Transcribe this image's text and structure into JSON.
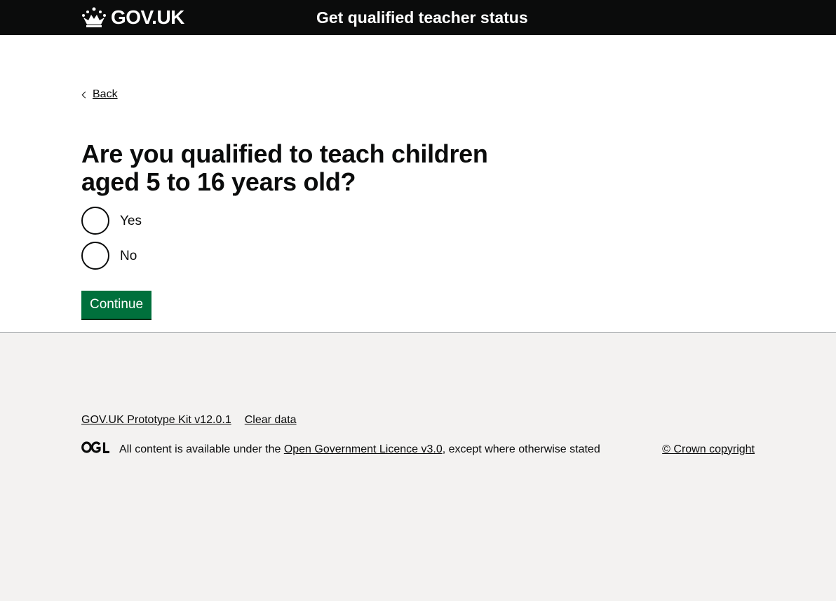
{
  "header": {
    "logo_text": "GOV.UK",
    "service_name": "Get qualified teacher status"
  },
  "nav": {
    "back_label": "Back"
  },
  "question": {
    "heading": "Are you qualified to teach children aged 5 to 16 years old?",
    "options": [
      {
        "label": "Yes",
        "selected": false
      },
      {
        "label": "No",
        "selected": false
      }
    ]
  },
  "actions": {
    "continue_label": "Continue"
  },
  "footer": {
    "links": [
      "GOV.UK Prototype Kit v12.0.1",
      "Clear data"
    ],
    "licence_prefix": "All content is available under the ",
    "licence_link": "Open Government Licence v3.0",
    "licence_suffix": ", except where otherwise stated",
    "copyright": "© Crown copyright"
  },
  "colors": {
    "header_bg": "#0b0c0c",
    "accent_blue": "#1d70b8",
    "button_green": "#00703c",
    "footer_bg": "#f3f2f1"
  }
}
